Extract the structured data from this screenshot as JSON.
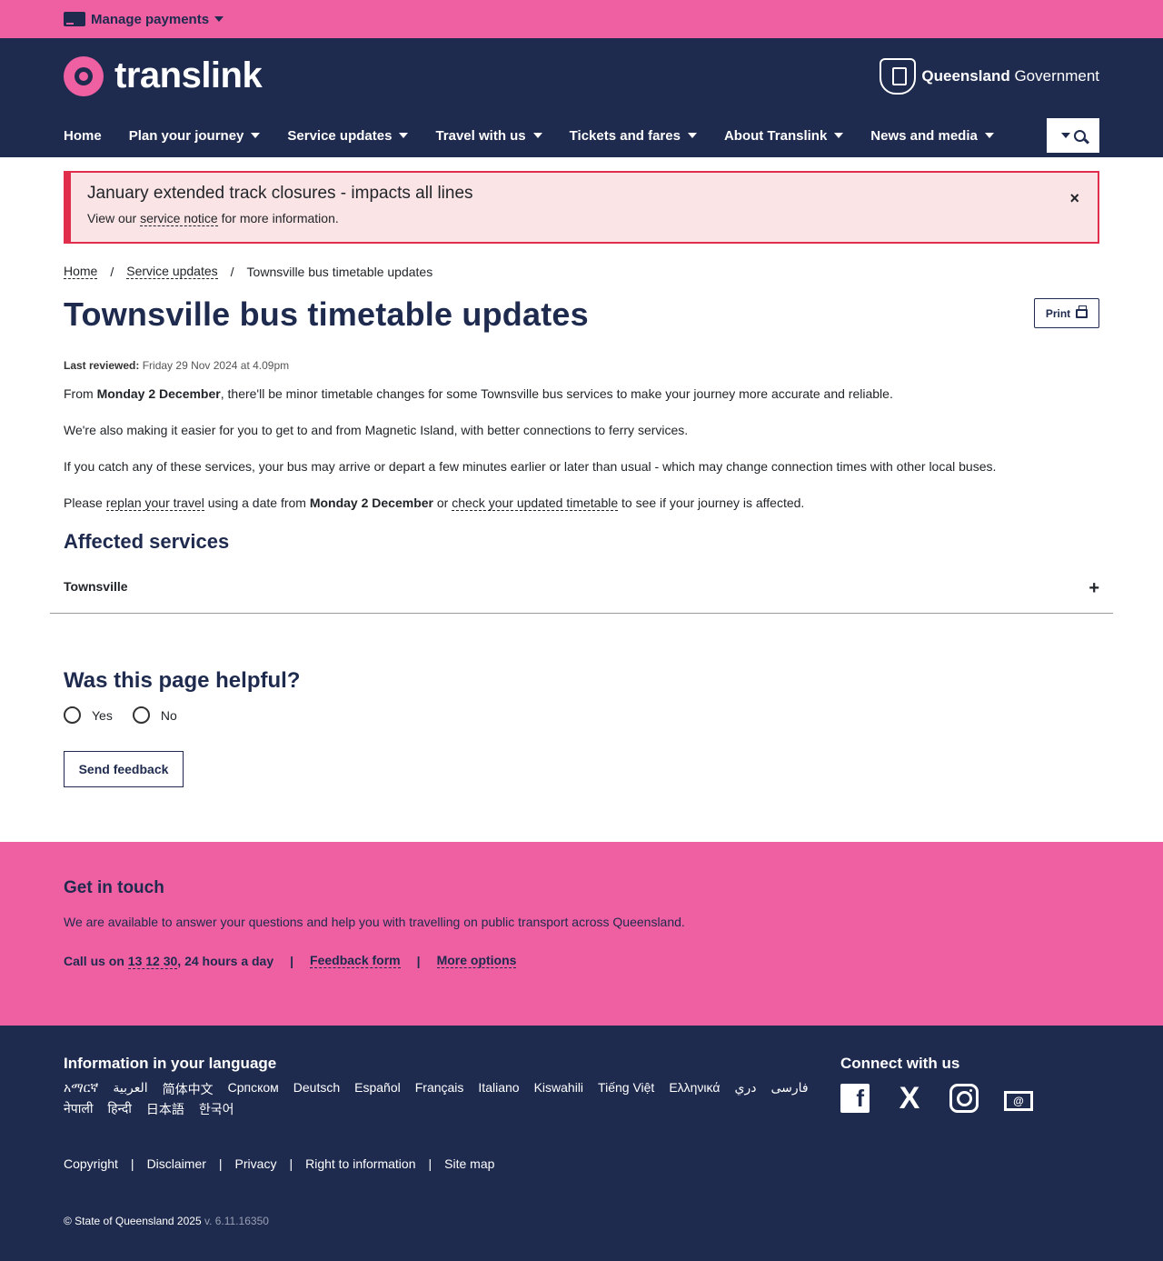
{
  "topbar": {
    "manage_payments": "Manage payments"
  },
  "brand": {
    "logo_text": "translink",
    "gov_bold": "Queensland",
    "gov_rest": "Government"
  },
  "nav": {
    "items": [
      {
        "label": "Home",
        "has_menu": false
      },
      {
        "label": "Plan your journey",
        "has_menu": true
      },
      {
        "label": "Service updates",
        "has_menu": true
      },
      {
        "label": "Travel with us",
        "has_menu": true
      },
      {
        "label": "Tickets and fares",
        "has_menu": true
      },
      {
        "label": "About Translink",
        "has_menu": true
      },
      {
        "label": "News and media",
        "has_menu": true
      }
    ]
  },
  "alert": {
    "title": "January extended track closures - impacts all lines",
    "body_prefix": "View our",
    "body_link": "service notice",
    "body_suffix": "for more information.",
    "close": "×"
  },
  "breadcrumb": {
    "home": "Home",
    "sep": "/",
    "service_updates": "Service updates",
    "current": "Townsville bus timetable updates"
  },
  "page": {
    "title": "Townsville bus timetable updates",
    "print_label": "Print",
    "reviewed_label": "Last reviewed:",
    "reviewed_value": "Friday 29 Nov 2024 at 4.09pm",
    "p1_a": "From",
    "p1_bold": "Monday 2 December",
    "p1_b": ", there'll be minor timetable changes for some Townsville bus services to make your journey more accurate and reliable.",
    "p2": "We're also making it easier for you to get to and from Magnetic Island, with better connections to ferry services.",
    "p3": "If you catch any of these services, your bus may arrive or depart a few minutes earlier or later than usual - which may change connection times with other local buses.",
    "p4_a": "Please",
    "p4_link1": "replan your travel",
    "p4_b": "using a date from",
    "p4_bold": "Monday 2 December",
    "p4_c": "or",
    "p4_link2": "check your updated timetable",
    "p4_d": "to see if your journey is affected.",
    "affected_heading": "Affected services",
    "accordion_label": "Townsville",
    "accordion_icon": "+"
  },
  "feedback": {
    "heading": "Was this page helpful?",
    "yes": "Yes",
    "no": "No",
    "send": "Send feedback"
  },
  "touch": {
    "heading": "Get in touch",
    "text": "We are available to answer your questions and help you with travelling on public transport across Queensland.",
    "call_prefix": "Call us on",
    "phone": "13 12 30",
    "call_suffix": ", 24 hours a day",
    "sep": "|",
    "feedback_form": "Feedback form",
    "more_options": "More options"
  },
  "footer": {
    "lang_heading": "Information in your language",
    "languages": [
      "አማርኛ",
      "العربية",
      "简体中文",
      "Српском",
      "Deutsch",
      "Español",
      "Français",
      "Italiano",
      "Kiswahili",
      "Tiếng Việt",
      "Ελληνικά",
      "دري",
      "فارسی",
      "नेपाली",
      "हिन्दी",
      "日本語",
      "한국어"
    ],
    "connect_heading": "Connect with us",
    "social": [
      "facebook-icon",
      "x-icon",
      "instagram-icon",
      "email-icon"
    ],
    "links": [
      "Copyright",
      "Disclaimer",
      "Privacy",
      "Right to information",
      "Site map"
    ],
    "link_sep": "|",
    "copyright": "© State of Queensland 2025",
    "version": "v. 6.11.16350"
  },
  "colors": {
    "pink": "#ef60a3",
    "navy": "#1e2a4e",
    "alert_red": "#e02d4b",
    "alert_bg": "#fbe4e6"
  }
}
